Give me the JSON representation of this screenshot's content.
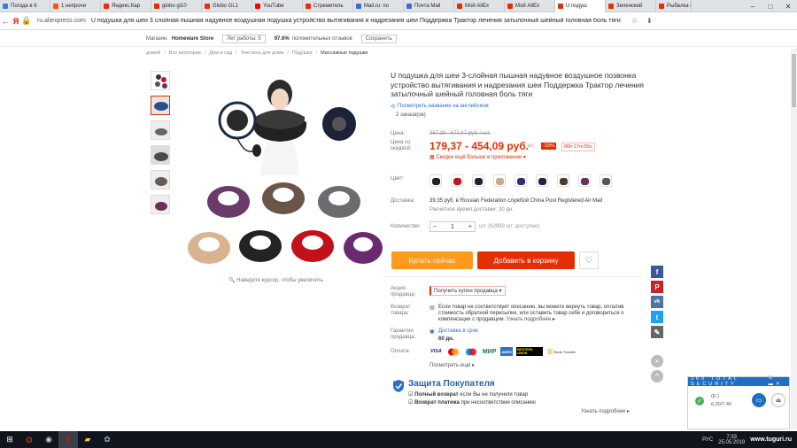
{
  "browser": {
    "tabs": [
      {
        "label": "Погода в К",
        "color": "#3b7dd8"
      },
      {
        "label": "1 непрочи",
        "color": "#ff5500"
      },
      {
        "label": "Яндекс.Кар",
        "color": "#e62e04"
      },
      {
        "label": "globo gl10",
        "color": "#e62e04"
      },
      {
        "label": "Globo GL1",
        "color": "#e62e04"
      },
      {
        "label": "YouTube",
        "color": "#ff0000"
      },
      {
        "label": "Стремитель",
        "color": "#e62e04"
      },
      {
        "label": "Mail.ru: по",
        "color": "#3b6dd8"
      },
      {
        "label": "Почта Mail",
        "color": "#3b6dd8"
      },
      {
        "label": "Мой AliEx",
        "color": "#e62e04"
      },
      {
        "label": "Мой AliEx",
        "color": "#e62e04"
      },
      {
        "label": "U подуш",
        "color": "#e62e04",
        "active": true
      },
      {
        "label": "Зеленский",
        "color": "#e62e04"
      },
      {
        "label": "Рыбалка в",
        "color": "#e62e04"
      }
    ],
    "url": "ru.aliexpress.com",
    "page_title": "U подушка для шеи 3 слойная пышная надувное воздушная подушка устройство вытягивания и надрезания шеи Поддержка Трактор лечения затылочный шейный головная боль тяги купить на Ali..."
  },
  "store": {
    "label": "Магазин:",
    "name": "Homeware Store",
    "years": "Лет работы: 5",
    "rating": "97.6%",
    "rating_label": "положительных отзывов",
    "save": "Сохранить"
  },
  "breadcrumb": [
    "домой",
    "Все категории",
    "Дом и сад",
    "Текстиль для дома",
    "Подушки",
    "Массажные подушки"
  ],
  "product": {
    "title": "U подушка для шеи 3-слойная пышная надувное воздушное позвонка устройство вытягивания и надрезания шеи Поддержка Трактор лечения затылочный шейный головная боль тяги",
    "english_link": "Посмотреть название на английском",
    "orders": "2 заказа(ов)",
    "zoom_hint": "Наведите курсор, чтобы увеличить"
  },
  "price": {
    "label": "Цена:",
    "old": "267,39 - 677,47 руб. / шт.",
    "discount_label": "Цена со скидкой:",
    "new": "179,37 - 454,09 руб.",
    "unit": "/ шт.",
    "percent": "-33%",
    "timer": "06h:17m:55s",
    "app_sale": "Скидки ещё больше в приложении"
  },
  "colors": {
    "label": "Цвет:",
    "swatches": [
      "#222222",
      "#c0171f",
      "#1c2238",
      "#c8a98a",
      "#2c2f6e",
      "#2a2246",
      "#4a3b2e",
      "#6b2f5a",
      "#5a5660"
    ]
  },
  "shipping": {
    "label": "Доставка:",
    "line1": "39,35 руб. в Russian Federation службой China Post Registered Air Mail",
    "line2": "Расчетное время доставки: 30 дн."
  },
  "quantity": {
    "label": "Количество:",
    "value": "1",
    "available": "шт. (62989 шт. доступно)"
  },
  "buttons": {
    "buy": "Купить сейчас",
    "cart": "Добавить в корзину"
  },
  "promo": {
    "label": "Акция продавца:",
    "coupon": "Получить купон продавца"
  },
  "returns": {
    "label": "Возврат товара:",
    "text": "Если товар не соответствует описанию, вы можете вернуть товар, оплатив стоимость обратной пересылки, или оставить товар себе и договориться о компенсации с продавцом.",
    "more": "Узнать подробнее"
  },
  "warranty": {
    "label": "Гарантии продавца:",
    "text": "Доставка в срок",
    "days": "60 дн."
  },
  "payment": {
    "label": "Оплата:",
    "methods": [
      "VISA",
      "MC",
      "Maestro",
      "МИР",
      "AmEx",
      "Western Union",
      "Bank Transfer"
    ],
    "more": "Посмотреть ещё"
  },
  "protection": {
    "title": "Защита Покупателя",
    "row1_bold": "Полный возврат",
    "row1": "если Вы не получили товар",
    "row2_bold": "Возврат платежа",
    "row2": "при несоответствии описанию",
    "more": "Узнать подробнее"
  },
  "security": {
    "title": "360 TOTAL SECURITY",
    "line1": "(E:)",
    "line2": "6.20/7.40"
  },
  "taskbar": {
    "lang": "РУС",
    "time": "7:33",
    "date": "25.05.2019",
    "watermark": "www.tuguri.ru"
  }
}
